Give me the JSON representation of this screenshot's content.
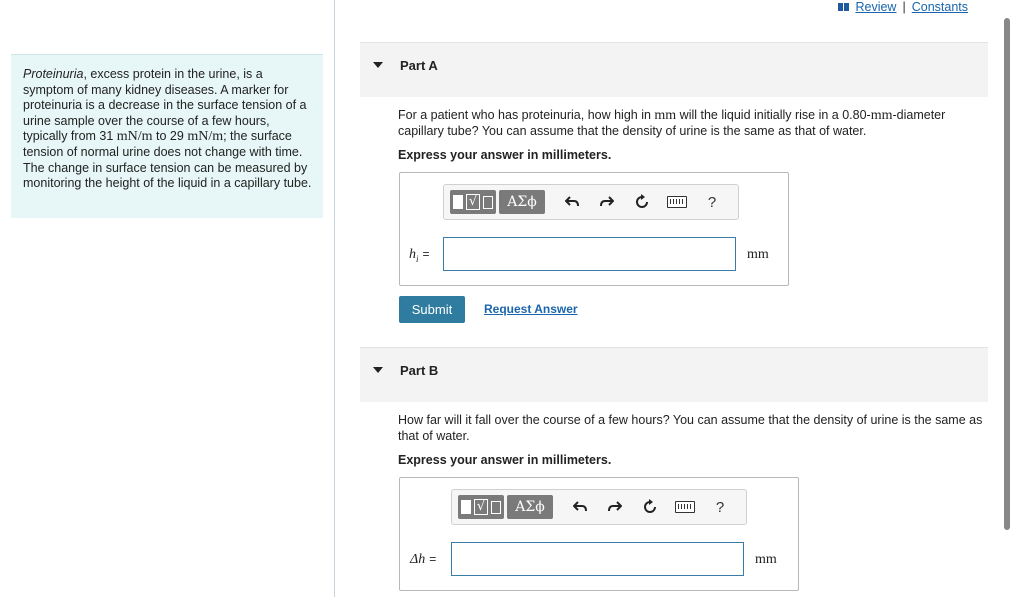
{
  "intro": {
    "term": "Proteinuria",
    "text_1": ", excess protein in the urine, is a symptom of many kidney diseases. A marker for proteinuria is a decrease in the surface tension of a urine sample over the course of a few hours, typically from 31 ",
    "unit_1": "mN/m",
    "text_2": " to 29 ",
    "unit_2": "mN/m",
    "text_3": "; the surface tension of normal urine does not change with time. The change in surface tension can be measured by monitoring the height of the liquid in a capillary tube."
  },
  "topbar": {
    "review_label": "Review",
    "separator": "|",
    "constants_label": "Constants"
  },
  "part_a": {
    "title": "Part A",
    "question_1": "For a patient who has proteinuria, how high in ",
    "question_unit_1": "mm",
    "question_2": " will the liquid initially rise in a 0.80-",
    "question_unit_2": "mm",
    "question_3": "-diameter capillary tube? You can assume that the density of urine is the same as that of water.",
    "express": "Express your answer in millimeters.",
    "var_main": "h",
    "var_sub": "i",
    "eq": "=",
    "input_value": "",
    "unit": "mm",
    "submit_label": "Submit",
    "request_label": "Request Answer"
  },
  "part_b": {
    "title": "Part B",
    "question": "How far will it fall over the course of a few hours? You can assume that the density of urine is the same as that of water.",
    "express": "Express your answer in millimeters.",
    "var_main": "Δh",
    "eq": "=",
    "input_value": "",
    "unit": "mm"
  },
  "toolbar": {
    "symbols_label": "ΑΣϕ",
    "sqrt_label": "√",
    "help_label": "?"
  },
  "icons": [
    "book-icon",
    "caret-down-icon",
    "templates-icon",
    "undo-icon",
    "redo-icon",
    "reset-icon",
    "keyboard-icon",
    "help-icon"
  ]
}
